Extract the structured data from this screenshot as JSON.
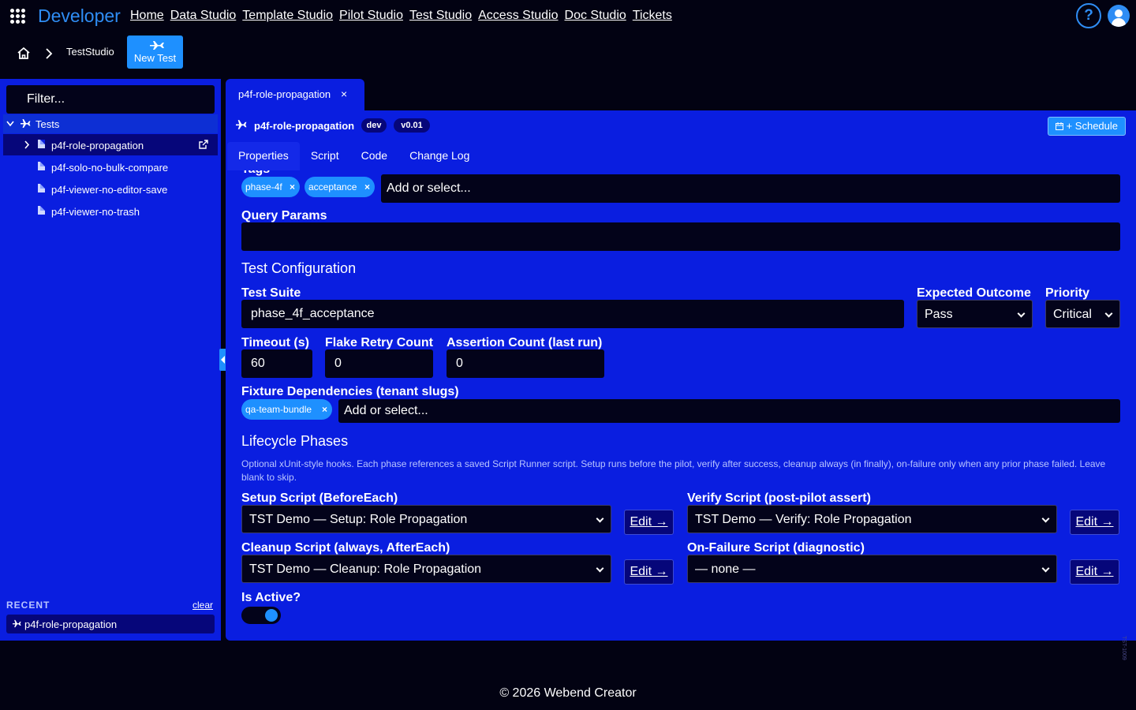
{
  "app": {
    "brand": "Developer"
  },
  "nav": {
    "links": [
      "Home",
      "Data Studio",
      "Template Studio",
      "Pilot Studio",
      "Test Studio",
      "Access Studio",
      "Doc Studio",
      "Tickets"
    ],
    "help": "?"
  },
  "breadcrumb": {
    "current": "TestStudio",
    "new_button": "New Test"
  },
  "sidebar": {
    "filter_placeholder": "Filter...",
    "root_label": "Tests",
    "items": [
      "p4f-role-propagation",
      "p4f-solo-no-bulk-compare",
      "p4f-viewer-no-editor-save",
      "p4f-viewer-no-trash"
    ],
    "recent_label": "RECENT",
    "recent_clear": "clear",
    "recent_items": [
      "p4f-role-propagation"
    ]
  },
  "doc_tab": {
    "label": "p4f-role-propagation",
    "close": "×"
  },
  "header": {
    "title": "p4f-role-propagation",
    "env_badge": "dev",
    "version_badge": "v0.01",
    "schedule_label": "+ Schedule"
  },
  "tabs": [
    "Properties",
    "Script",
    "Code",
    "Change Log"
  ],
  "form": {
    "tags_label": "Tags",
    "tags": [
      "phase-4f",
      "acceptance"
    ],
    "tags_placeholder": "Add or select...",
    "query_params_label": "Query Params",
    "query_params_value": "",
    "test_config_heading": "Test Configuration",
    "test_suite_label": "Test Suite",
    "test_suite_value": "phase_4f_acceptance",
    "expected_outcome_label": "Expected Outcome",
    "expected_outcome_value": "Pass",
    "priority_label": "Priority",
    "priority_value": "Critical",
    "timeout_label": "Timeout (s)",
    "timeout_value": "60",
    "flake_label": "Flake Retry Count",
    "flake_value": "0",
    "assertion_label": "Assertion Count (last run)",
    "assertion_value": "0",
    "fixture_label": "Fixture Dependencies (tenant slugs)",
    "fixture_chips": [
      "qa-team-bundle"
    ],
    "fixture_placeholder": "Add or select...",
    "lifecycle_heading": "Lifecycle Phases",
    "lifecycle_desc": "Optional xUnit-style hooks. Each phase references a saved Script Runner script. Setup runs before the pilot, verify after success, cleanup always (in finally), on-failure only when any prior phase failed. Leave blank to skip.",
    "setup_label": "Setup Script (BeforeEach)",
    "setup_value": "TST Demo — Setup: Role Propagation",
    "verify_label": "Verify Script (post-pilot assert)",
    "verify_value": "TST Demo — Verify: Role Propagation",
    "cleanup_label": "Cleanup Script (always, AfterEach)",
    "cleanup_value": "TST Demo — Cleanup: Role Propagation",
    "onfailure_label": "On-Failure Script (diagnostic)",
    "onfailure_value": "— none —",
    "edit_label": "Edit →",
    "active_label": "Is Active?",
    "active_value": true
  },
  "footer": {
    "text": "© 2026 Webend Creator",
    "version": "TST-1009"
  }
}
